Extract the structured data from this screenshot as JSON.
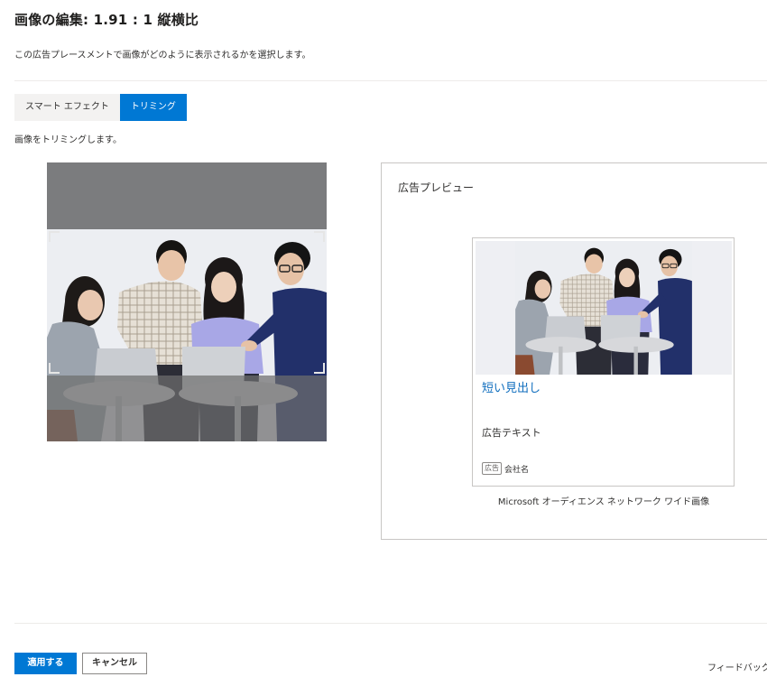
{
  "header": {
    "title": "画像の編集: 1.91 : 1 縦横比",
    "subtitle": "この広告プレースメントで画像がどのように表示されるかを選択します。"
  },
  "tabs": [
    {
      "label": "スマート エフェクト",
      "active": false
    },
    {
      "label": "トリミング",
      "active": true
    }
  ],
  "hint": "画像をトリミングします。",
  "preview": {
    "title": "広告プレビュー",
    "headline": "短い見出し",
    "ad_text": "広告テキスト",
    "ad_badge": "広告",
    "company": "会社名",
    "caption": "Microsoft オーディエンス ネットワーク ワイド画像"
  },
  "footer": {
    "apply_label": "適用する",
    "cancel_label": "キャンセル",
    "feedback_label": "フィードバックを送"
  },
  "colors": {
    "accent": "#0078d4",
    "link": "#106ebe",
    "border": "#c8c6c4"
  }
}
